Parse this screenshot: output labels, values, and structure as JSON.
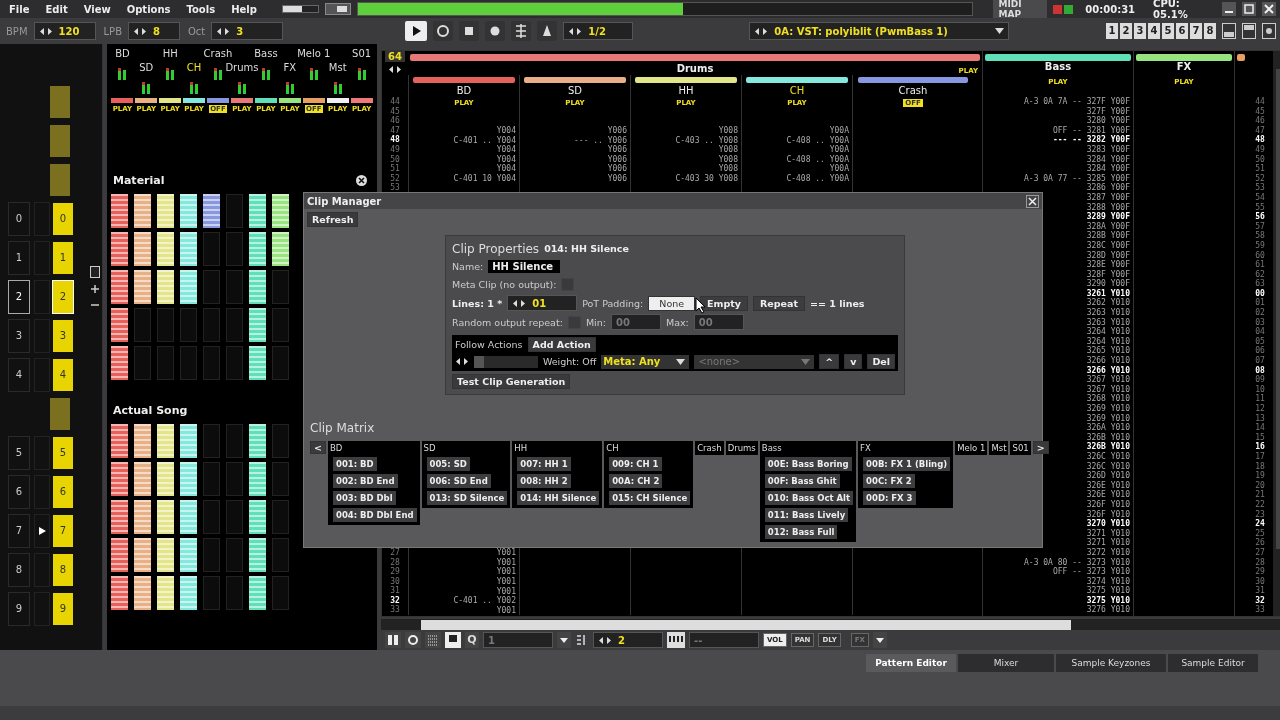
{
  "menu": [
    "File",
    "Edit",
    "View",
    "Options",
    "Tools",
    "Help"
  ],
  "status": {
    "volume": {
      "level": 0.55
    },
    "midi_map": "MIDI MAP",
    "time": "00:00:31",
    "cpu": "CPU: 05.1%"
  },
  "transport": {
    "bpm_label": "BPM",
    "bpm": "120",
    "lpb_label": "LPB",
    "lpb": "8",
    "oct_label": "Oct",
    "oct": "3",
    "step": "1/2",
    "instrument": "0A: VST: polyiblit (PwmBass 1)",
    "track_buttons": [
      "1",
      "2",
      "3",
      "4",
      "5",
      "6",
      "7",
      "8"
    ]
  },
  "sequence": [
    {
      "kind": "block"
    },
    {
      "kind": "block"
    },
    {
      "kind": "block"
    },
    {
      "kind": "slot",
      "row": "0",
      "pattern": "0",
      "selected": false,
      "playing": false
    },
    {
      "kind": "slot",
      "row": "1",
      "pattern": "1",
      "selected": false,
      "playing": false
    },
    {
      "kind": "slot",
      "row": "2",
      "pattern": "2",
      "selected": true,
      "playing": false
    },
    {
      "kind": "slot",
      "row": "3",
      "pattern": "3",
      "selected": false,
      "playing": false
    },
    {
      "kind": "slot",
      "row": "4",
      "pattern": "4",
      "selected": false,
      "playing": false
    },
    {
      "kind": "block"
    },
    {
      "kind": "slot",
      "row": "5",
      "pattern": "5",
      "selected": false,
      "playing": false
    },
    {
      "kind": "slot",
      "row": "6",
      "pattern": "6",
      "selected": false,
      "playing": false
    },
    {
      "kind": "slot",
      "row": "7",
      "pattern": "7",
      "selected": false,
      "playing": true
    },
    {
      "kind": "slot",
      "row": "8",
      "pattern": "8",
      "selected": false,
      "playing": false
    },
    {
      "kind": "slot",
      "row": "9",
      "pattern": "9",
      "selected": false,
      "playing": false
    }
  ],
  "mixer": [
    {
      "name": "BD",
      "color": "#e8605a",
      "status": "PLAY",
      "active": true,
      "selected": false
    },
    {
      "name": "SD",
      "color": "#e8b084",
      "status": "PLAY",
      "active": true,
      "selected": false
    },
    {
      "name": "HH",
      "color": "#e4e488",
      "status": "PLAY",
      "active": true,
      "selected": false
    },
    {
      "name": "CH",
      "color": "#84e8dc",
      "status": "PLAY",
      "active": true,
      "selected": true
    },
    {
      "name": "Crash",
      "color": "#8898e0",
      "status": "OFF",
      "active": false,
      "selected": false
    },
    {
      "name": "Drums",
      "color": "#e87878",
      "status": "PLAY",
      "active": true,
      "selected": false
    },
    {
      "name": "Bass",
      "color": "#60e0b8",
      "status": "PLAY",
      "active": true,
      "selected": false
    },
    {
      "name": "FX",
      "color": "#98e480",
      "status": "PLAY",
      "active": true,
      "selected": false
    },
    {
      "name": "Melo 1",
      "color": "#e8a060",
      "status": "OFF",
      "active": false,
      "selected": false
    },
    {
      "name": "Mst",
      "color": "#f0f0f0",
      "status": "PLAY",
      "active": true,
      "selected": false
    },
    {
      "name": "S01",
      "color": "#f07878",
      "status": "PLAY",
      "active": true,
      "selected": false
    }
  ],
  "material": {
    "title": "Material",
    "grid": [
      [
        true,
        true,
        true,
        true,
        true,
        false,
        true,
        true
      ],
      [
        true,
        true,
        true,
        true,
        false,
        false,
        true,
        true
      ],
      [
        true,
        true,
        true,
        true,
        false,
        false,
        true,
        false
      ],
      [
        true,
        false,
        false,
        false,
        false,
        false,
        true,
        false
      ],
      [
        true,
        false,
        false,
        false,
        false,
        false,
        true,
        false
      ]
    ]
  },
  "song": {
    "title": "Actual Song",
    "grid": [
      [
        true,
        true,
        true,
        true,
        false,
        false,
        true,
        false
      ],
      [
        true,
        true,
        true,
        true,
        false,
        false,
        true,
        false
      ],
      [
        true,
        true,
        true,
        true,
        false,
        false,
        true,
        false
      ],
      [
        true,
        true,
        true,
        true,
        false,
        false,
        true,
        false
      ],
      [
        true,
        true,
        true,
        true,
        false,
        false,
        true,
        false
      ]
    ]
  },
  "pattern": {
    "length": "64",
    "group": {
      "name": "Drums",
      "color": "#e87878",
      "status": "PLAY",
      "active": true
    },
    "tracks": [
      {
        "name": "BD",
        "color": "#e8605a",
        "status": "PLAY",
        "active": true,
        "selected": false
      },
      {
        "name": "SD",
        "color": "#e8b084",
        "status": "PLAY",
        "active": true,
        "selected": false
      },
      {
        "name": "HH",
        "color": "#e4e488",
        "status": "PLAY",
        "active": true,
        "selected": false
      },
      {
        "name": "CH",
        "color": "#84e8dc",
        "status": "PLAY",
        "active": true,
        "selected": true
      },
      {
        "name": "Crash",
        "color": "#8898e0",
        "status": "OFF",
        "active": false,
        "selected": false
      }
    ],
    "bass": {
      "name": "Bass",
      "color": "#60e0b8",
      "status": "PLAY",
      "active": true
    },
    "fx": {
      "name": "FX",
      "color": "#98e480",
      "status": "PLAY",
      "active": true
    },
    "rows": [
      {
        "line": "44",
        "left_line": "44",
        "beat": false,
        "bass": "A-3 0A 7A -- 327F Y00F"
      },
      {
        "line": "45",
        "left_line": "45",
        "beat": false,
        "bass": "327F Y00F"
      },
      {
        "line": "46",
        "left_line": "46",
        "beat": false,
        "bass": "3280 Y00F"
      },
      {
        "line": "47",
        "left_line": "47",
        "beat": false,
        "bass": "OFF -- 3281 Y00F",
        "drums": [
          "Y004",
          "Y006",
          "Y008",
          "Y00A"
        ]
      },
      {
        "line": "48",
        "left_line": "48",
        "beat": true,
        "bass": "--- -- 3282 Y00F",
        "drums": [
          "C-401 .. Y004",
          "--- .. Y006",
          "C-403 .. Y008",
          "C-408 .. Y00A"
        ]
      },
      {
        "line": "49",
        "left_line": "49",
        "beat": false,
        "bass": "3283 Y00F",
        "drums": [
          "Y004",
          "Y006",
          "Y008",
          "Y00A"
        ]
      },
      {
        "line": "50",
        "left_line": "50",
        "beat": false,
        "bass": "3284 Y00F",
        "drums": [
          "Y004",
          "Y006",
          "Y008",
          "C-408 .. Y00A"
        ]
      },
      {
        "line": "51",
        "left_line": "51",
        "beat": false,
        "bass": "3284 Y00F",
        "drums": [
          "Y004",
          "Y006",
          "Y008",
          "Y00A"
        ]
      },
      {
        "line": "52",
        "left_line": "52",
        "beat": false,
        "bass": "A-3 0A 77 -- 3285 Y00F",
        "drums": [
          "C-401 10 Y004",
          "Y006",
          "C-403 30 Y008",
          "C-408 .. Y00A"
        ]
      },
      {
        "line": "53",
        "left_line": "53",
        "beat": false,
        "bass": "3286 Y00F"
      },
      {
        "line": "54",
        "beat": false,
        "bass": "3287 Y00F"
      },
      {
        "line": "55",
        "beat": false,
        "bass": "3288 Y00F"
      },
      {
        "line": "56",
        "beat": true,
        "bass": "3289 Y00F"
      },
      {
        "line": "57",
        "beat": false,
        "bass": "328A Y00F"
      },
      {
        "line": "58",
        "beat": false,
        "bass": "328B Y00F"
      },
      {
        "line": "59",
        "beat": false,
        "bass": "328C Y00F"
      },
      {
        "line": "60",
        "beat": false,
        "bass": "328D Y00F"
      },
      {
        "line": "61",
        "beat": false,
        "bass": "328E Y00F"
      },
      {
        "line": "62",
        "beat": false,
        "bass": "328F Y00F"
      },
      {
        "line": "63",
        "beat": false,
        "bass": "3290 Y00F"
      },
      {
        "line": "00",
        "beat": true,
        "bass": "3261 Y010"
      },
      {
        "line": "01",
        "beat": false,
        "bass": "3262 Y010"
      },
      {
        "line": "02",
        "beat": false,
        "bass": "3263 Y010"
      },
      {
        "line": "03",
        "beat": false,
        "bass": "3263 Y010"
      },
      {
        "line": "04",
        "beat": false,
        "bass": "3264 Y010"
      },
      {
        "line": "05",
        "beat": false,
        "bass": "3264 Y010"
      },
      {
        "line": "06",
        "beat": false,
        "bass": "3265 Y010"
      },
      {
        "line": "07",
        "beat": false,
        "bass": "3266 Y010"
      },
      {
        "line": "08",
        "beat": true,
        "bass": "3266 Y010"
      },
      {
        "line": "09",
        "beat": false,
        "bass": "3267 Y010"
      },
      {
        "line": "10",
        "beat": false,
        "bass": "3267 Y010"
      },
      {
        "line": "11",
        "beat": false,
        "bass": "3268 Y010"
      },
      {
        "line": "12",
        "beat": false,
        "bass": "3269 Y010"
      },
      {
        "line": "13",
        "beat": false,
        "bass": "3269 Y010"
      },
      {
        "line": "14",
        "beat": false,
        "bass": "326A Y010"
      },
      {
        "line": "15",
        "beat": false,
        "bass": "326B Y010"
      },
      {
        "line": "16",
        "beat": true,
        "bass": "326B Y010"
      },
      {
        "line": "17",
        "beat": false,
        "bass": "326C Y010"
      },
      {
        "line": "18",
        "beat": false,
        "bass": "326C Y010"
      },
      {
        "line": "19",
        "beat": false,
        "bass": "326D Y010"
      },
      {
        "line": "20",
        "beat": false,
        "bass": "326E Y010"
      },
      {
        "line": "21",
        "beat": false,
        "bass": "326E Y010"
      },
      {
        "line": "22",
        "beat": false,
        "bass": "326F Y010"
      },
      {
        "line": "23",
        "beat": false,
        "bass": "326F Y010"
      },
      {
        "line": "24",
        "beat": true,
        "bass": "3270 Y010"
      },
      {
        "line": "25",
        "beat": false,
        "bass": "3271 Y010"
      },
      {
        "line": "26",
        "beat": false,
        "bass": "3271 Y010"
      },
      {
        "line": "27",
        "left_line": "27",
        "beat": false,
        "bass": "3272 Y010",
        "drums": [
          "Y001"
        ]
      },
      {
        "line": "28",
        "left_line": "28",
        "beat": false,
        "bass": "A-3 0A 80 -- 3273 Y010",
        "drums": [
          "Y001"
        ]
      },
      {
        "line": "29",
        "left_line": "29",
        "beat": false,
        "bass": "OFF -- 3273 Y010",
        "drums": [
          "Y001"
        ]
      },
      {
        "line": "30",
        "left_line": "30",
        "beat": false,
        "bass": "3274 Y010",
        "drums": [
          "Y001"
        ]
      },
      {
        "line": "31",
        "left_line": "31",
        "beat": false,
        "bass": "3275 Y010",
        "drums": [
          "Y001"
        ]
      },
      {
        "line": "32",
        "left_line": "32",
        "beat": true,
        "bass": "3275 Y010",
        "drums": [
          "C-401 .. Y002"
        ]
      },
      {
        "line": "33",
        "left_line": "33",
        "beat": false,
        "bass": "3276 Y010",
        "drums": [
          "Y001"
        ]
      }
    ]
  },
  "toolbar": {
    "q": "Q",
    "quant": "1",
    "step": "2",
    "keys": "--",
    "vol": "VOL",
    "pan": "PAN",
    "dly": "DLY",
    "fx": "FX"
  },
  "tabs": [
    {
      "label": "Pattern Editor",
      "selected": true
    },
    {
      "label": "Mixer",
      "selected": false
    },
    {
      "label": "Sample Keyzones",
      "selected": false
    },
    {
      "label": "Sample Editor",
      "selected": false
    }
  ],
  "clip_manager": {
    "title": "Clip Manager",
    "refresh": "Refresh",
    "properties": {
      "heading": "Clip Properties",
      "clip": "014: HH Silence",
      "name_label": "Name:",
      "name": "HH Silence",
      "meta_label": "Meta Clip (no output):",
      "meta_checked": false,
      "lines_label": "Lines: 1 *",
      "lines": "01",
      "padding_label": "PoT Padding:",
      "padding_options": [
        {
          "label": "None",
          "selected": true
        },
        {
          "label": "Empty",
          "selected": false
        },
        {
          "label": "Repeat",
          "selected": false
        }
      ],
      "lines_result": "== 1 lines",
      "random_label": "Random output repeat:",
      "random_checked": false,
      "min_label": "Min:",
      "min": "00",
      "max_label": "Max:",
      "max": "00",
      "follow_label": "Follow Actions",
      "add_action": "Add Action",
      "weight_slider": {
        "level": 0.15
      },
      "weight": "Weight: Off",
      "meta": "Meta: Any",
      "target": "<none>",
      "up": "^",
      "down": "v",
      "del": "Del",
      "test": "Test Clip Generation"
    },
    "matrix": {
      "title": "Clip Matrix",
      "prev": "<",
      "next": ">",
      "groups": [
        {
          "name": "BD",
          "clips": [
            "001: BD",
            "002: BD End",
            "003: BD Dbl",
            "004: BD Dbl End"
          ]
        },
        {
          "name": "SD",
          "clips": [
            "005: SD",
            "006: SD End",
            "013: SD Silence"
          ]
        },
        {
          "name": "HH",
          "clips": [
            "007: HH 1",
            "008: HH 2",
            "014: HH Silence"
          ]
        },
        {
          "name": "CH",
          "clips": [
            "009: CH 1",
            "00A: CH 2",
            "015: CH Silence"
          ]
        },
        {
          "name": "Crash"
        },
        {
          "name": "Drums"
        },
        {
          "name": "Bass",
          "clips": [
            "00E: Bass Boring",
            "00F: Bass Ghit",
            "010: Bass Oct Alt",
            "011: Bass Lively",
            "012: Bass Full"
          ]
        },
        {
          "name": "FX",
          "clips": [
            "00B: FX 1 (Bling)",
            "00C: FX 2",
            "00D: FX 3"
          ]
        },
        {
          "name": "Melo 1"
        },
        {
          "name": "Mst"
        },
        {
          "name": "S01"
        }
      ]
    }
  }
}
